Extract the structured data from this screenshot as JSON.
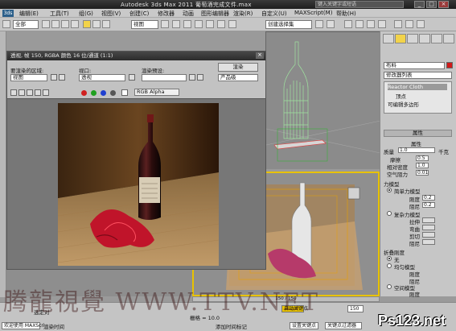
{
  "app": {
    "title": "Autodesk 3ds Max  2011     葡萄酒完成文件.max",
    "search_placeholder": "键入关键字或短语",
    "window_controls": [
      "_",
      "□",
      "×"
    ]
  },
  "menu": {
    "logo": "3ds",
    "items": [
      "编辑(E)",
      "工具(T)",
      "组(G)",
      "视图(V)",
      "创建(C)",
      "修改器",
      "动画",
      "图形编辑器",
      "渲染(R)",
      "自定义(U)",
      "MAXScript(M)",
      "帮助(H)"
    ]
  },
  "toolbar": {
    "selection_filter": "全部",
    "ref_coord": "视图",
    "named_selection": "创建选择集"
  },
  "render_window": {
    "title": "透视, 帧 150, RGBA 颜色 16 位/通道 (1:1)",
    "area_label": "要渲染的区域:",
    "area_value": "视图",
    "viewport_label": "视口:",
    "viewport_value": "透视",
    "preset_label": "渲染预设:",
    "preset_value": "",
    "render_button": "渲染",
    "mode_value": "产品级",
    "channel_value": "RGB Alpha"
  },
  "command_panel": {
    "object_name": "布料",
    "modifier_list": "修改器列表",
    "stack": [
      "Reactor Cloth",
      "顶点",
      "可编辑多边形"
    ],
    "properties_rollout": "属性",
    "props_title": "属性",
    "mass_label": "质量",
    "mass_value": "1.0",
    "mass_unit": "千克",
    "friction_label": "摩擦",
    "friction_value": "0.5",
    "relative_density_label": "相对密度",
    "relative_density_value": "1.0",
    "air_resistance_label": "空气阻力",
    "air_resistance_value": "0.01",
    "force_model_title": "力模型",
    "simple_force_label": "简单力模型",
    "stiffness_label": "刚度",
    "stiffness_value": "0.2",
    "damping_label": "阻尼",
    "damping_value": "0.2",
    "complex_force_label": "复杂力模型",
    "stretch_label": "拉伸",
    "bend_label": "弯曲",
    "shear_label": "剪切",
    "damp2_label": "阻尼",
    "fold_title": "折叠刚度",
    "fold_none": "无",
    "fold_uniform": "均匀模型",
    "fold_stiff_label": "刚度",
    "fold_damp_label": "阻尼",
    "fold_space": "空间模型",
    "space_stiff_label": "刚度",
    "space_dist_label": "距离",
    "space_expand_label": "扩散角度"
  },
  "timeline": {
    "frame_readout": "150 / 150"
  },
  "status": {
    "welcome": "欢迎使用 MAXScri",
    "rendering_time": "渲染时间",
    "frame_label": "栅格 = 10.0",
    "add_time_tag": "添加时间标记",
    "auto_key": "自动关键点",
    "set_key": "设置关键点",
    "key_filter": "关键点过滤器",
    "selected_label": "选定对",
    "frame_value": "150"
  },
  "watermark": {
    "left": "腾龍視覺 WWW.TTV.NET",
    "right": "Ps123.net"
  },
  "colors": {
    "accent_yellow": "#e8c200",
    "wireframe_green": "#9fe39f",
    "cloth_red": "#c0142a"
  }
}
